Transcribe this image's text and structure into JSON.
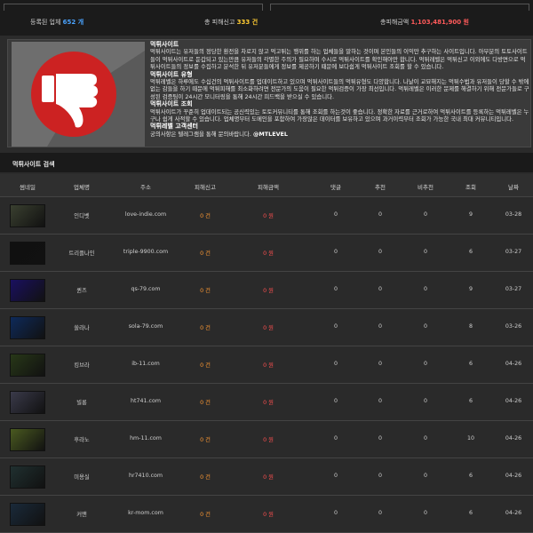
{
  "stats": {
    "registered_label": "등록된 업체",
    "registered_value": "652 개",
    "reports_label": "총 피해신고",
    "reports_value": "333 건",
    "amount_label": "총피해금액",
    "amount_value": "1,103,481,900 원"
  },
  "info": {
    "sec1_title": "먹튀사이트",
    "sec1_body": "먹튀사이트는 유저들의 정당한 환전을 차로지 않고 먹고튀는 행위를 하는 업체들을 말하는 것이며 본인들의 이익만 추구하는 사이트입니다. 아무분의 토토사이트들이 먹튀사이트로 둔갑되고 있는만큼 유저들의 각별한 주의가 필요하며 수시로 먹튀사이트를 확인해야만 합니다. 먹튀레벨은 먹튀신고 이외에도 다방면으로 먹튀사이트들의 정보를 수집하고 분석한 뒤 유저분들에게 정보를 제공하기 때문에 보다쉽게 먹튀사이트 조회를 할 수 있습니다.",
    "sec2_title": "먹튀사이트 유형",
    "sec2_body": "먹튀레벨은 하루에도 수십건의 먹튀사이트를 업데이트하고 있으며 먹튀사이트들의 먹튀유형도 다양합니다. 나날이 교묘해지는 먹튀수법과 유저들이 당할 수 밖에 없는 감들을 하기 때문에 먹튀피해를 최소화하려면 전문가의 도움이 필요한 먹튀검증이 가장 최선입니다. 먹튀레벨은 이러한 문제를 해결하기 위해 전문가들로 구성된 검증팀이 24시간 모니터링을 통해 24시간 피드백을 받으실 수 있습니다.",
    "sec3_title": "먹튀사이트 조회",
    "sec3_body": "먹튀사이트가 꾸준히 업데이트되는 공신력있는 토토커뮤니티를 통해 조회를 하는것이 좋습니다. 정확한 자료를 근거로하여 먹튀사이트를 등록하는 먹튀레벨은 누구나 쉽게 사적할 수 있습니다. 업체명부터 도메인을 포함하여 가장많은 데이터를 보유하고 있으며 과거이력부터 조회가 가능한 국내 최대 커뮤니티입니다.",
    "sec4_title": "먹튀레벨 고객센터",
    "sec4_body": "궁의사항은 텔레그램을 통해 문의바랍니다.",
    "contact": "@MTLEVEL"
  },
  "search": {
    "title": "먹튀사이트 검색"
  },
  "columns": [
    "썸네일",
    "업체명",
    "주소",
    "피해신고",
    "피해금액",
    "댓글",
    "추천",
    "비추천",
    "조회",
    "날짜"
  ],
  "rows": [
    {
      "name": "인디벳",
      "url": "love-indie.com",
      "reports": "0 건",
      "amount": "0 원",
      "comments": "0",
      "up": "0",
      "down": "0",
      "views": "9",
      "date": "03-28"
    },
    {
      "name": "트리플나인",
      "url": "triple-9900.com",
      "reports": "0 건",
      "amount": "0 원",
      "comments": "0",
      "up": "0",
      "down": "0",
      "views": "6",
      "date": "03-27"
    },
    {
      "name": "퀸즈",
      "url": "qs-79.com",
      "reports": "0 건",
      "amount": "0 원",
      "comments": "0",
      "up": "0",
      "down": "0",
      "views": "9",
      "date": "03-27"
    },
    {
      "name": "쏠라나",
      "url": "sola-79.com",
      "reports": "0 건",
      "amount": "0 원",
      "comments": "0",
      "up": "0",
      "down": "0",
      "views": "8",
      "date": "03-26"
    },
    {
      "name": "킹브라",
      "url": "ib-11.com",
      "reports": "0 건",
      "amount": "0 원",
      "comments": "0",
      "up": "0",
      "down": "0",
      "views": "6",
      "date": "04-26"
    },
    {
      "name": "빌롱",
      "url": "ht741.com",
      "reports": "0 건",
      "amount": "0 원",
      "comments": "0",
      "up": "0",
      "down": "0",
      "views": "6",
      "date": "04-26"
    },
    {
      "name": "후라노",
      "url": "hm-11.com",
      "reports": "0 건",
      "amount": "0 원",
      "comments": "0",
      "up": "0",
      "down": "0",
      "views": "10",
      "date": "04-26"
    },
    {
      "name": "미용실",
      "url": "hr7410.com",
      "reports": "0 건",
      "amount": "0 원",
      "comments": "0",
      "up": "0",
      "down": "0",
      "views": "6",
      "date": "04-26"
    },
    {
      "name": "커맨",
      "url": "kr-mom.com",
      "reports": "0 건",
      "amount": "0 원",
      "comments": "0",
      "up": "0",
      "down": "0",
      "views": "6",
      "date": "04-26"
    }
  ],
  "thumb_colors": [
    "#3a4030",
    "#101010",
    "#1a1060",
    "#0e2a5a",
    "#283818",
    "#3a3a4a",
    "#4a5a20",
    "#203030",
    "#1a2a3a"
  ],
  "icon": {
    "name": "thumbs-down-icon",
    "circle": "#cc2222",
    "hand": "#ffffff"
  }
}
